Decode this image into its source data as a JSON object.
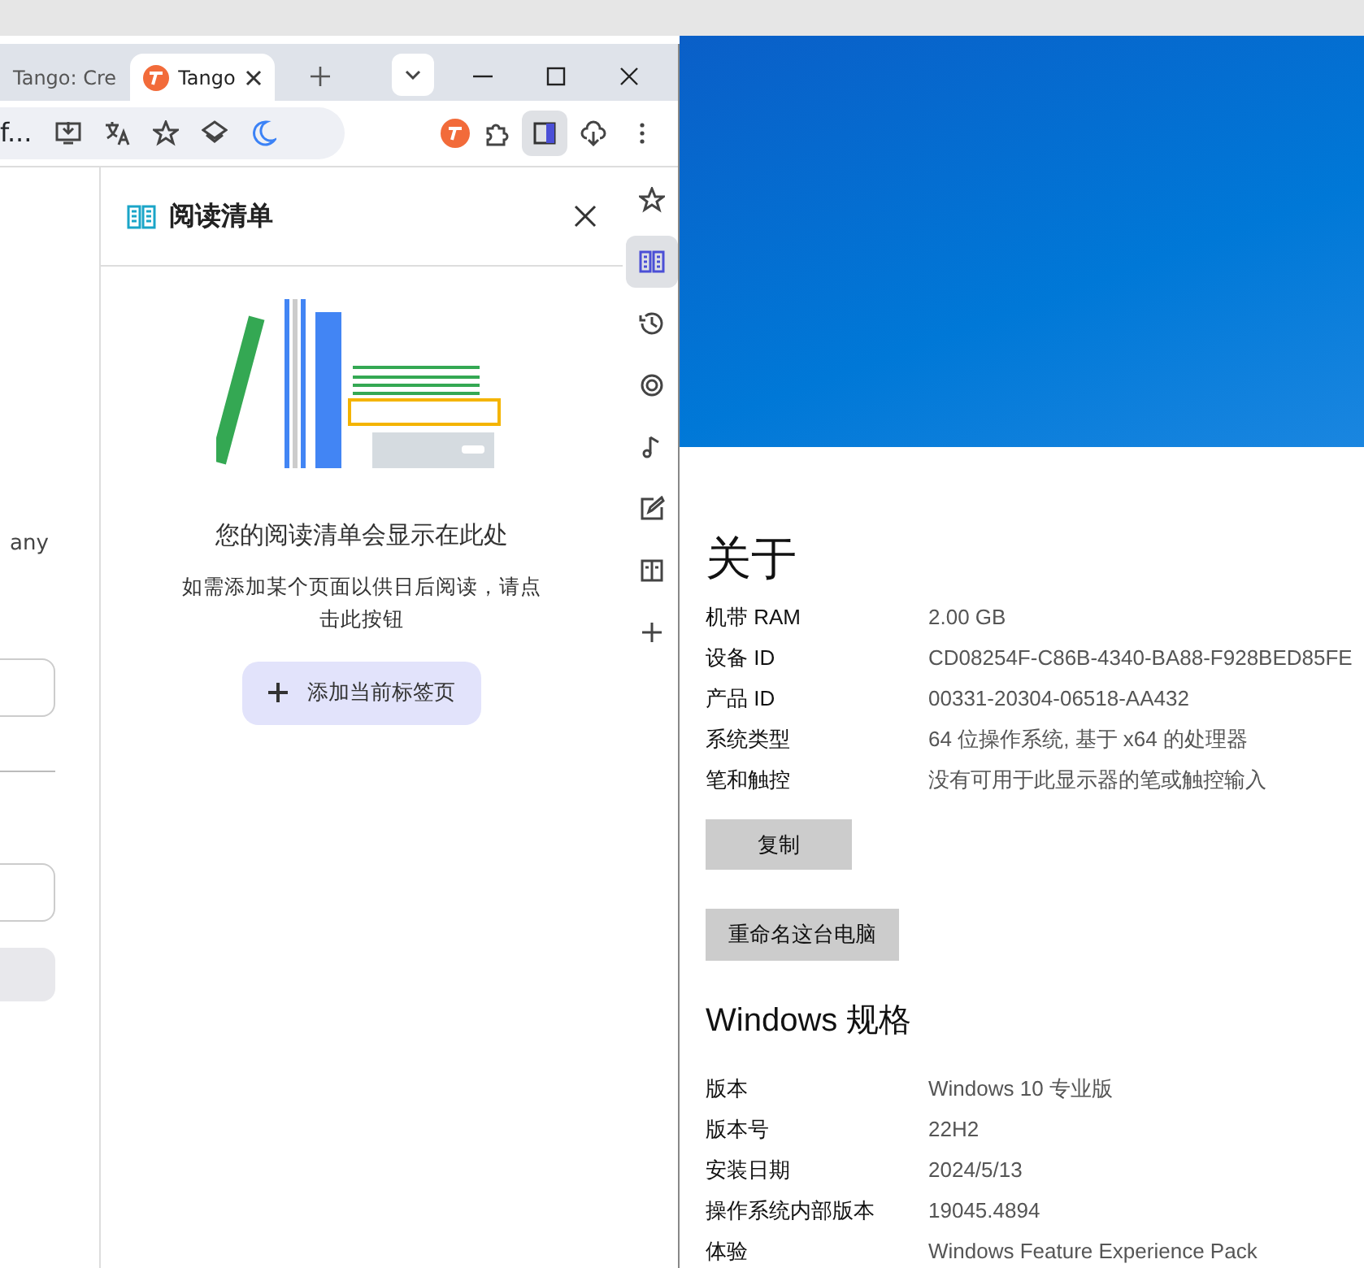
{
  "browser": {
    "tabs": [
      {
        "title": "Tango: Cre",
        "selected": false
      },
      {
        "title": "Tango",
        "selected": true
      }
    ],
    "address_text": "f...",
    "page_text": "any",
    "side_panel": {
      "title": "阅读清单",
      "empty_title": "您的阅读清单会显示在此处",
      "empty_text": "如需添加某个页面以供日后阅读，请点击此按钮",
      "add_button": "添加当前标签页"
    },
    "side_icons": [
      {
        "kind": "star",
        "selected": false
      },
      {
        "kind": "book",
        "selected": true
      },
      {
        "kind": "history",
        "selected": false
      },
      {
        "kind": "lens",
        "selected": false
      },
      {
        "kind": "music",
        "selected": false
      },
      {
        "kind": "edit",
        "selected": false
      },
      {
        "kind": "reader",
        "selected": false
      },
      {
        "kind": "plus",
        "selected": false
      }
    ]
  },
  "settings": {
    "title": "关于",
    "rows": [
      {
        "label": "机带 RAM",
        "value": "2.00 GB"
      },
      {
        "label": "设备 ID",
        "value": "CD08254F-C86B-4340-BA88-F928BED85FE"
      },
      {
        "label": "产品 ID",
        "value": "00331-20304-06518-AA432"
      },
      {
        "label": "系统类型",
        "value": "64 位操作系统, 基于 x64 的处理器"
      },
      {
        "label": "笔和触控",
        "value": "没有可用于此显示器的笔或触控输入"
      }
    ],
    "buttons": [
      "复制",
      "重命名这台电脑"
    ],
    "section_title": "Windows 规格",
    "spec_rows": [
      {
        "label": "版本",
        "value": "Windows 10 专业版"
      },
      {
        "label": "版本号",
        "value": "22H2"
      },
      {
        "label": "安装日期",
        "value": "2024/5/13"
      },
      {
        "label": "操作系统内部版本",
        "value": "19045.4894"
      },
      {
        "label": "体验",
        "value": "Windows Feature Experience Pack"
      }
    ]
  }
}
